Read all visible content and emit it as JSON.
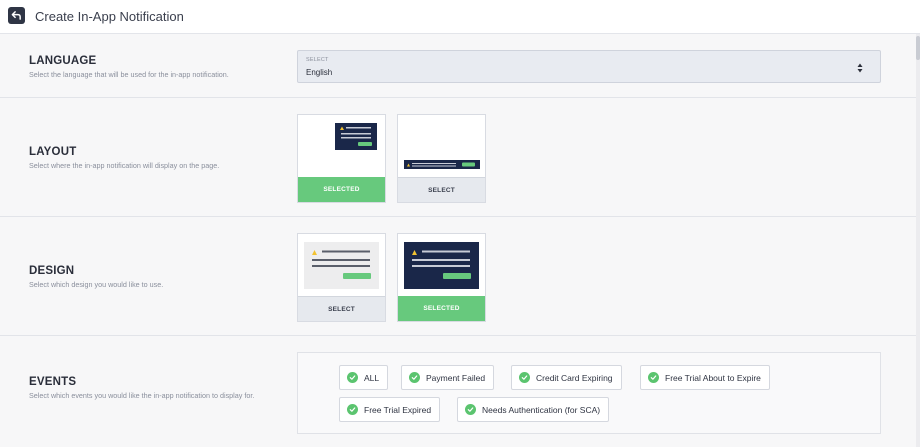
{
  "header": {
    "title": "Create In-App Notification"
  },
  "language": {
    "title": "LANGUAGE",
    "description": "Select the language that will be used for the in-app notification.",
    "select_label": "SELECT",
    "select_value": "English"
  },
  "layout": {
    "title": "LAYOUT",
    "description": "Select where the in-app notification will display on the page.",
    "options": [
      {
        "button": "SELECTED",
        "selected": true
      },
      {
        "button": "SELECT",
        "selected": false
      }
    ]
  },
  "design": {
    "title": "DESIGN",
    "description": "Select which design you would like to use.",
    "options": [
      {
        "button": "SELECT",
        "selected": false
      },
      {
        "button": "SELECTED",
        "selected": true
      }
    ]
  },
  "events": {
    "title": "EVENTS",
    "description": "Select which events you would like the in-app notification to display for.",
    "chips": [
      {
        "label": "ALL",
        "checked": true
      },
      {
        "label": "Payment Failed",
        "checked": true
      },
      {
        "label": "Credit Card Expiring",
        "checked": true
      },
      {
        "label": "Free Trial About to Expire",
        "checked": true
      },
      {
        "label": "Free Trial Expired",
        "checked": true
      },
      {
        "label": "Needs Authentication (for SCA)",
        "checked": true
      }
    ]
  },
  "colors": {
    "selected_green": "#67c97d",
    "check_green": "#5bc46f",
    "navy": "#1a2749",
    "warning_yellow": "#f2c230"
  },
  "icons": {
    "back": "back-arrow-icon",
    "caret": "sort-caret-icon",
    "check": "check-circle-icon",
    "warning": "warning-icon"
  }
}
